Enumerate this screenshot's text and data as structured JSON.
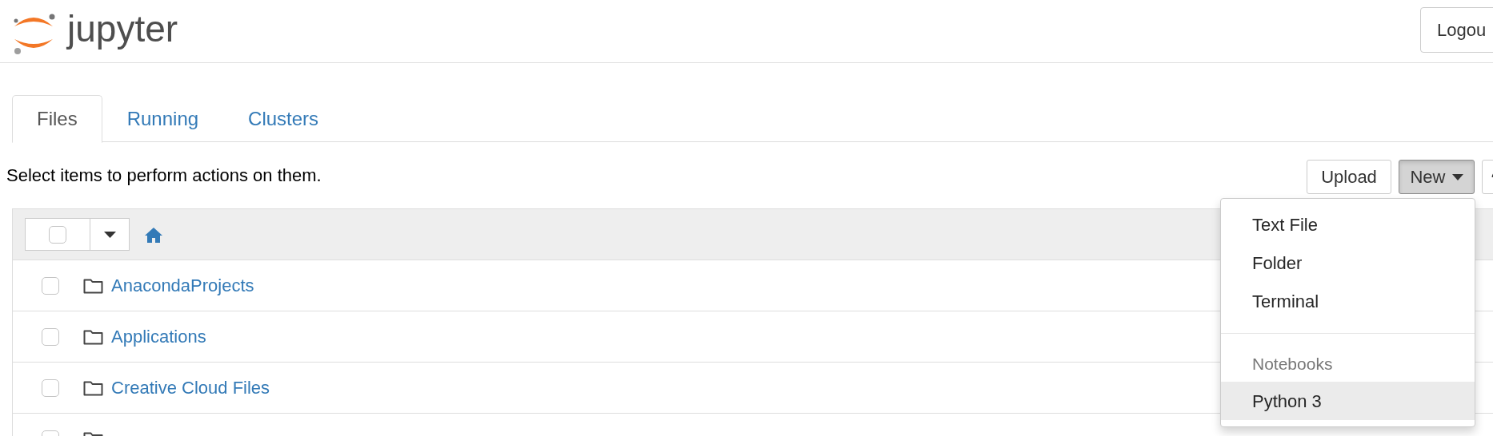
{
  "header": {
    "logo_text": "jupyter",
    "logout_button": "Logou"
  },
  "tabs": [
    {
      "label": "Files",
      "selected": true
    },
    {
      "label": "Running",
      "selected": false
    },
    {
      "label": "Clusters",
      "selected": false
    }
  ],
  "toolbar": {
    "hint": "Select items to perform actions on them.",
    "buttons": [
      {
        "kind": "text",
        "label": "Upload",
        "pressed": false
      },
      {
        "kind": "dropdown",
        "label": "New",
        "pressed": true
      },
      {
        "kind": "icon",
        "pressed": false
      }
    ]
  },
  "new_menu": {
    "open": true,
    "items": [
      {
        "kind": "item",
        "label": "Text File",
        "highlighted": false
      },
      {
        "kind": "item",
        "label": "Folder",
        "highlighted": false
      },
      {
        "kind": "item",
        "label": "Terminal",
        "highlighted": false
      },
      {
        "kind": "divider"
      },
      {
        "kind": "header",
        "label": "Notebooks"
      },
      {
        "kind": "item",
        "label": "Python 3",
        "highlighted": true
      }
    ]
  },
  "file_list": {
    "select_all_checked": false,
    "rows": [
      {
        "name": "AnacondaProjects",
        "checked": false
      },
      {
        "name": "Applications",
        "checked": false
      },
      {
        "name": "Creative Cloud Files",
        "checked": false
      },
      {
        "checked": false
      }
    ]
  }
}
